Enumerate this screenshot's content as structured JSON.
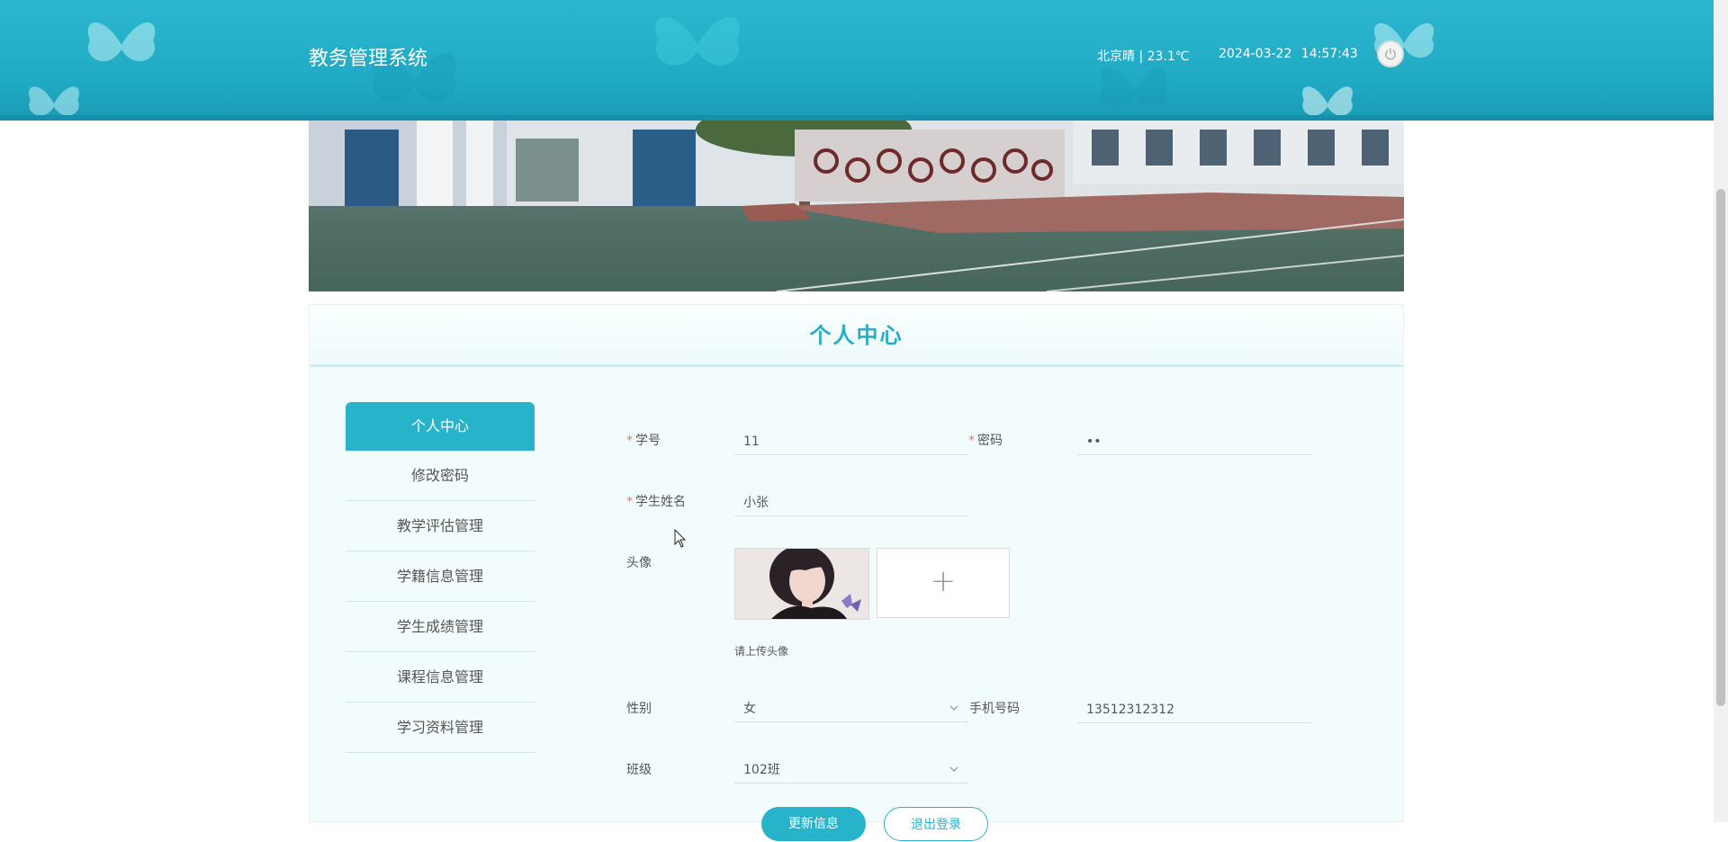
{
  "header": {
    "title": "教务管理系统",
    "weather": "北京晴 | 23.1℃",
    "datetime": "2024-03-22  14:57:43",
    "power_icon": "power-icon"
  },
  "panel": {
    "title": "个人中心"
  },
  "menu": {
    "items": [
      {
        "label": "个人中心"
      },
      {
        "label": "修改密码"
      },
      {
        "label": "教学评估管理"
      },
      {
        "label": "学籍信息管理"
      },
      {
        "label": "学生成绩管理"
      },
      {
        "label": "课程信息管理"
      },
      {
        "label": "学习资料管理"
      }
    ]
  },
  "form": {
    "student_no": {
      "label": "学号",
      "value": "11"
    },
    "password": {
      "label": "密码",
      "value": "••"
    },
    "student_name": {
      "label": "学生姓名",
      "value": "小张"
    },
    "avatar": {
      "label": "头像",
      "hint": "请上传头像",
      "upload_icon": "+"
    },
    "gender": {
      "label": "性别",
      "value": "女"
    },
    "phone": {
      "label": "手机号码",
      "value": "13512312312"
    },
    "class": {
      "label": "班级",
      "value": "102班"
    },
    "submit_label": "更新信息",
    "logout_label": "退出登录"
  },
  "colors": {
    "accent": "#27b4cb",
    "header": "#20a9c3",
    "required": "#f56c6c"
  }
}
